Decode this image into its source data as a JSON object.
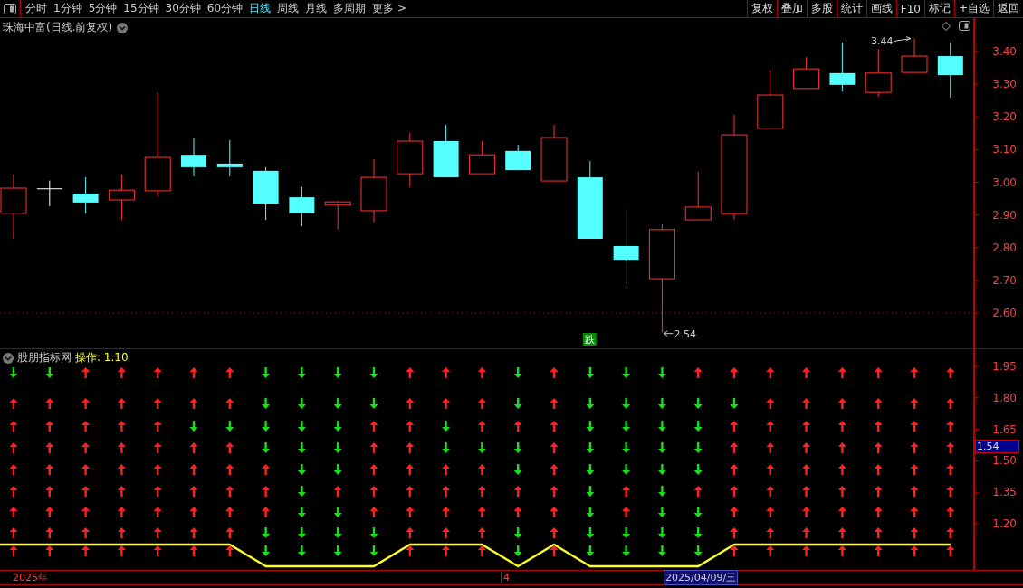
{
  "toolbar": {
    "periods": [
      {
        "label": "分时",
        "selected": false
      },
      {
        "label": "1分钟",
        "selected": false
      },
      {
        "label": "5分钟",
        "selected": false
      },
      {
        "label": "15分钟",
        "selected": false
      },
      {
        "label": "30分钟",
        "selected": false
      },
      {
        "label": "60分钟",
        "selected": false
      },
      {
        "label": "日线",
        "selected": true
      },
      {
        "label": "周线",
        "selected": false
      },
      {
        "label": "月线",
        "selected": false
      },
      {
        "label": "多周期",
        "selected": false
      },
      {
        "label": "更多 >",
        "selected": false
      }
    ],
    "actions": [
      "复权",
      "叠加",
      "多股",
      "统计",
      "画线",
      "F10",
      "标记",
      "+自选",
      "返回"
    ]
  },
  "price_panel": {
    "title": "珠海中富(日线.前复权)",
    "high_label": "3.44",
    "low_label": "2.54",
    "signal_badge": "跌",
    "axis_labels": [
      "3.40",
      "3.30",
      "3.20",
      "3.10",
      "3.00",
      "2.90",
      "2.80",
      "2.70",
      "2.60"
    ]
  },
  "indicator_panel": {
    "name": "股朋指标网",
    "reading": "操作: 1.10",
    "axis_labels": [
      "1.95",
      "1.80",
      "1.65",
      "1.50",
      "1.35",
      "1.20"
    ],
    "current_value": "1.54",
    "arrow_rows": [
      {
        "up": [
          false,
          false,
          true,
          true,
          true,
          true,
          true,
          false,
          false,
          false,
          false,
          true,
          true,
          true,
          false,
          true,
          false,
          false,
          false,
          true,
          true,
          true,
          true,
          true,
          true,
          true,
          true
        ]
      },
      {
        "up": [
          true,
          true,
          true,
          true,
          true,
          true,
          true,
          false,
          false,
          false,
          false,
          true,
          true,
          true,
          false,
          true,
          false,
          false,
          false,
          false,
          false,
          true,
          true,
          true,
          true,
          true,
          true
        ]
      },
      {
        "up": [
          true,
          true,
          true,
          true,
          true,
          false,
          false,
          false,
          false,
          false,
          true,
          true,
          false,
          true,
          true,
          true,
          false,
          false,
          false,
          false,
          true,
          true,
          true,
          true,
          true,
          true,
          true
        ]
      },
      {
        "up": [
          true,
          true,
          true,
          true,
          true,
          true,
          true,
          false,
          false,
          false,
          true,
          true,
          false,
          false,
          false,
          true,
          false,
          false,
          false,
          false,
          true,
          true,
          true,
          true,
          true,
          true,
          true
        ]
      },
      {
        "up": [
          true,
          true,
          true,
          true,
          true,
          true,
          true,
          true,
          false,
          false,
          true,
          true,
          true,
          true,
          false,
          true,
          false,
          false,
          false,
          false,
          true,
          true,
          true,
          true,
          true,
          true,
          true
        ]
      },
      {
        "up": [
          true,
          true,
          true,
          true,
          true,
          true,
          true,
          true,
          false,
          true,
          true,
          true,
          true,
          true,
          true,
          true,
          false,
          true,
          false,
          true,
          true,
          true,
          true,
          true,
          true,
          true,
          true
        ]
      },
      {
        "up": [
          true,
          true,
          true,
          true,
          true,
          true,
          true,
          true,
          false,
          false,
          true,
          true,
          true,
          true,
          true,
          true,
          false,
          true,
          false,
          false,
          true,
          true,
          true,
          true,
          true,
          true,
          true
        ]
      },
      {
        "up": [
          true,
          true,
          true,
          true,
          true,
          true,
          true,
          false,
          false,
          false,
          false,
          true,
          true,
          true,
          false,
          true,
          false,
          false,
          false,
          false,
          true,
          true,
          true,
          true,
          true,
          true,
          true
        ]
      },
      {
        "up": [
          true,
          true,
          true,
          true,
          true,
          true,
          true,
          false,
          false,
          false,
          false,
          true,
          true,
          true,
          false,
          true,
          false,
          false,
          false,
          false,
          true,
          true,
          true,
          true,
          true,
          true,
          true
        ]
      }
    ]
  },
  "date_bar": {
    "year": "2025年",
    "month": "4",
    "cursor_date": "2025/04/09/三"
  }
}
